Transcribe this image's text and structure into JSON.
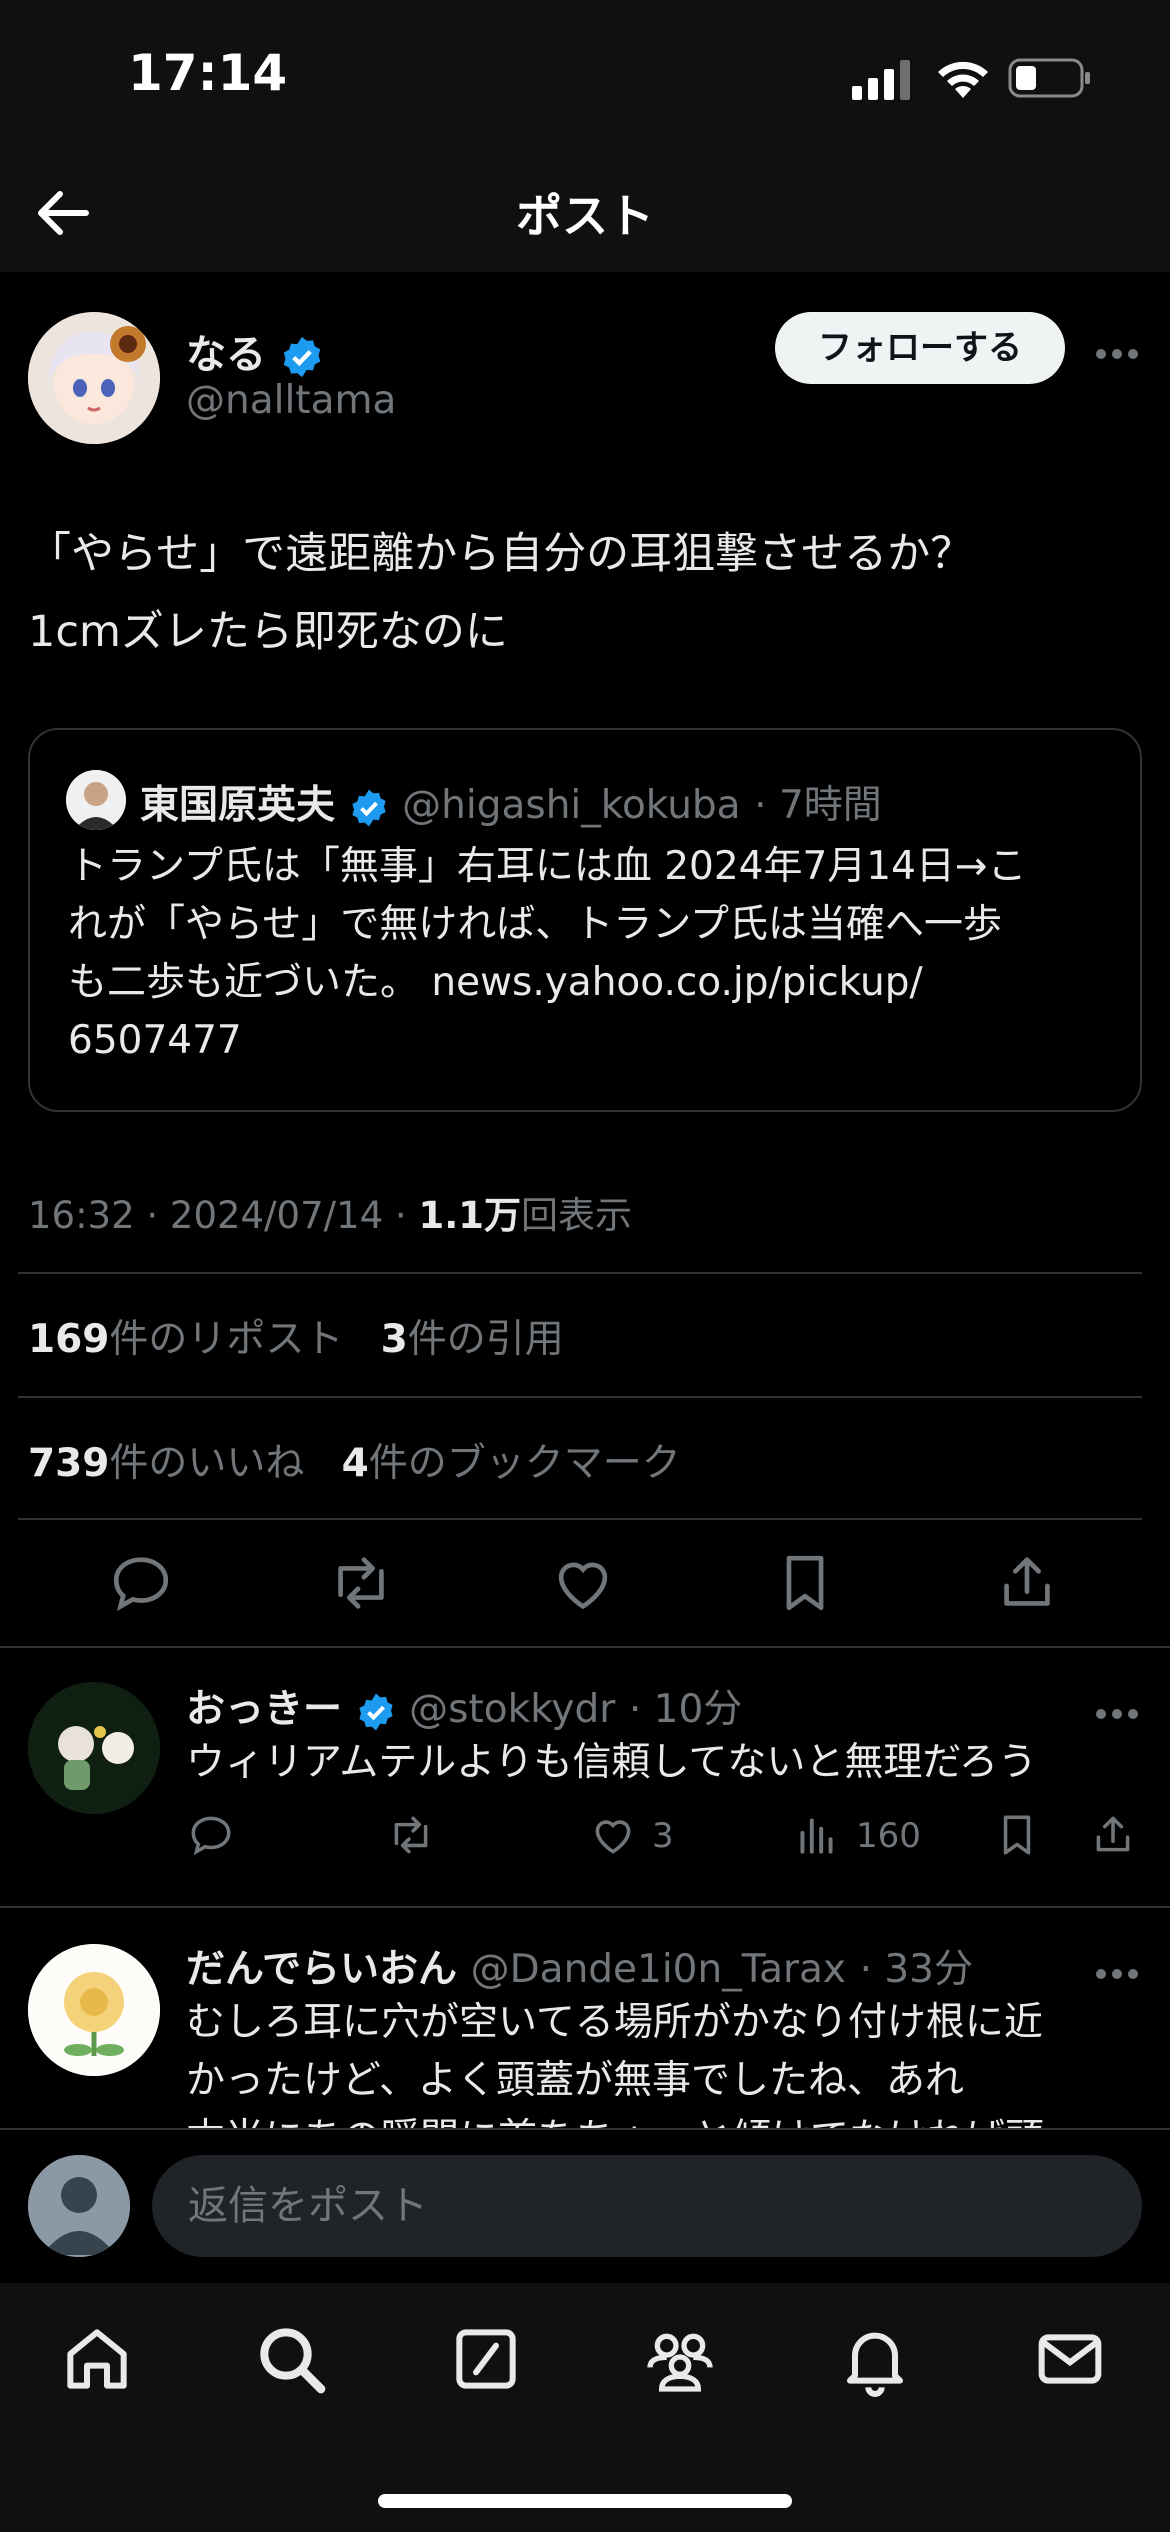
{
  "status_bar": {
    "time": "17:14"
  },
  "nav": {
    "title": "ポスト"
  },
  "post": {
    "author_name": "なる",
    "author_handle": "@nalltama",
    "follow_label": "フォローする",
    "text_line1": "「やらせ」で遠距離から自分の耳狙撃させるか？",
    "text_line2": "1cmズレたら即死なのに",
    "quote": {
      "author_name": "東国原英夫",
      "author_handle": "@higashi_kokuba",
      "time": "· 7時間",
      "text_line1": "トランプ氏は「無事」右耳には血 2024年7月14日→こ",
      "text_line2": "れが「やらせ」で無ければ、トランプ氏は当確へ一歩",
      "text_line3": "も二歩も近づいた。 news.yahoo.co.jp/pickup/",
      "text_line4": "6507477"
    },
    "meta_time": "16:32 · 2024/07/14 · ",
    "meta_views": "1.1万",
    "meta_views_label": "回表示",
    "reposts_count": "169",
    "reposts_label": "件のリポスト",
    "quotes_count": "3",
    "quotes_label": "件の引用",
    "likes_count": "739",
    "likes_label": "件のいいね",
    "bookmarks_count": "4",
    "bookmarks_label": "件のブックマーク"
  },
  "replies": [
    {
      "author_name": "おっきー",
      "author_handle": "@stokkydr",
      "time": "· 10分",
      "text_line1": "ウィリアムテルよりも信頼してないと無理だろう",
      "likes": "3",
      "views": "160"
    },
    {
      "author_name": "だんでらいおん",
      "author_handle": "@Dande1i0n_Tarax",
      "time": "· 33分",
      "text_line1": "むしろ耳に穴が空いてる場所がかなり付け根に近",
      "text_line2": "かったけど、よく頭蓋が無事でしたね、あれ",
      "text_line3": "本当にあの瞬間に首をちょっと傾けてなければ頭"
    }
  ],
  "reply_bar": {
    "placeholder": "返信をポスト"
  },
  "colors": {
    "background": "#000000",
    "accent": "#1d9bf0",
    "muted": "#71767b",
    "text": "#e7e9ea"
  },
  "icons": [
    "back-arrow-icon",
    "verified-badge-icon",
    "more-icon",
    "reply-icon",
    "repost-icon",
    "like-icon",
    "bookmark-icon",
    "share-icon",
    "views-icon",
    "home-icon",
    "search-icon",
    "compose-icon",
    "communities-icon",
    "notifications-icon",
    "messages-icon"
  ]
}
